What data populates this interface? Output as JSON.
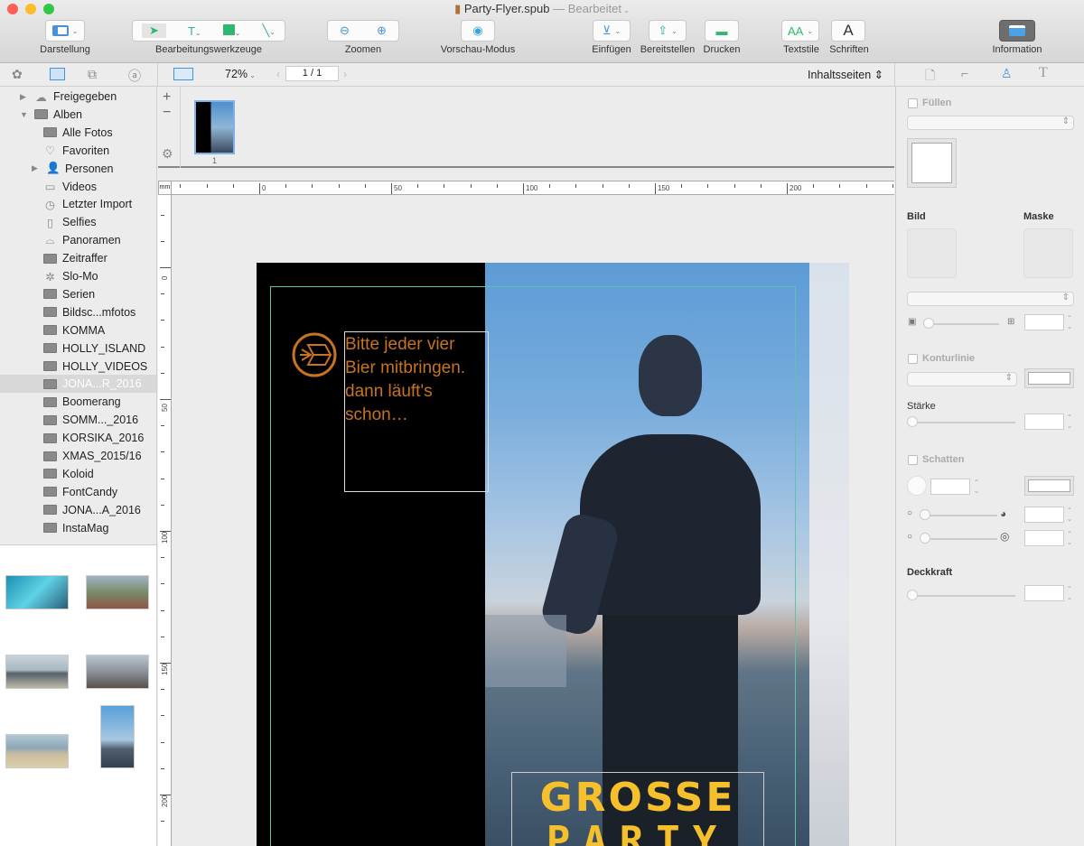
{
  "window": {
    "title": "Party-Flyer.spub",
    "status": "— Bearbeitet",
    "traffic_colors": [
      "#fc5f57",
      "#fdbc2e",
      "#33c748"
    ]
  },
  "toolbar": {
    "darstellung": "Darstellung",
    "bearbeitungswerkzeuge": "Bearbeitungswerkzeuge",
    "zoomen": "Zoomen",
    "vorschau": "Vorschau-Modus",
    "einfuegen": "Einfügen",
    "bereitstellen": "Bereitstellen",
    "drucken": "Drucken",
    "textstile": "Textstile",
    "schriften": "Schriften",
    "information": "Information",
    "font_glyph": "A",
    "text_tool_glyph": "T",
    "textstile_glyph": "AA"
  },
  "secbar": {
    "zoom": "72%",
    "page": "1 / 1",
    "page_type": "Inhaltsseiten"
  },
  "sidebar": {
    "items": [
      {
        "label": "Freigegeben",
        "icon": "cloud-icon"
      },
      {
        "label": "Alben",
        "icon": "album-icon"
      },
      {
        "label": "Alle Fotos",
        "icon": "album-icon"
      },
      {
        "label": "Favoriten",
        "icon": "heart-icon"
      },
      {
        "label": "Personen",
        "icon": "person-icon"
      },
      {
        "label": "Videos",
        "icon": "video-icon"
      },
      {
        "label": "Letzter Import",
        "icon": "clock-icon"
      },
      {
        "label": "Selfies",
        "icon": "selfie-icon"
      },
      {
        "label": "Panoramen",
        "icon": "panorama-icon"
      },
      {
        "label": "Zeitraffer",
        "icon": "album-icon"
      },
      {
        "label": "Slo-Mo",
        "icon": "slomo-icon"
      },
      {
        "label": "Serien",
        "icon": "album-icon"
      },
      {
        "label": "Bildsc...mfotos",
        "icon": "album-icon"
      },
      {
        "label": "KOMMA",
        "icon": "album-icon"
      },
      {
        "label": "HOLLY_ISLAND",
        "icon": "album-icon"
      },
      {
        "label": "HOLLY_VIDEOS",
        "icon": "album-icon"
      },
      {
        "label": "JONA...R_2016",
        "icon": "album-icon",
        "selected": true
      },
      {
        "label": "Boomerang",
        "icon": "album-icon"
      },
      {
        "label": "SOMM..._2016",
        "icon": "album-icon"
      },
      {
        "label": "KORSIKA_2016",
        "icon": "album-icon"
      },
      {
        "label": "XMAS_2015/16",
        "icon": "album-icon"
      },
      {
        "label": "Koloid",
        "icon": "album-icon"
      },
      {
        "label": "FontCandy",
        "icon": "album-icon"
      },
      {
        "label": "JONA...A_2016",
        "icon": "album-icon"
      },
      {
        "label": "InstaMag",
        "icon": "album-icon"
      }
    ]
  },
  "pages": {
    "thumb_number": "1"
  },
  "ruler": {
    "unit": "mm",
    "h_labels": [
      "0",
      "50",
      "100",
      "150",
      "200"
    ],
    "v_labels": [
      "0",
      "50",
      "100",
      "150",
      "200"
    ]
  },
  "flyer": {
    "text": [
      "Bitte jeder vier",
      "Bier mitbringen.",
      "dann läuft's",
      "schon…"
    ],
    "headline": "GROSSE",
    "headline2": "PARTY",
    "text_color": "#c8731f",
    "headline_color": "#f5c02c"
  },
  "inspector": {
    "fill": "Füllen",
    "image": "Bild",
    "mask": "Maske",
    "stroke": "Konturlinie",
    "strength": "Stärke",
    "shadow": "Schatten",
    "opacity": "Deckkraft"
  }
}
